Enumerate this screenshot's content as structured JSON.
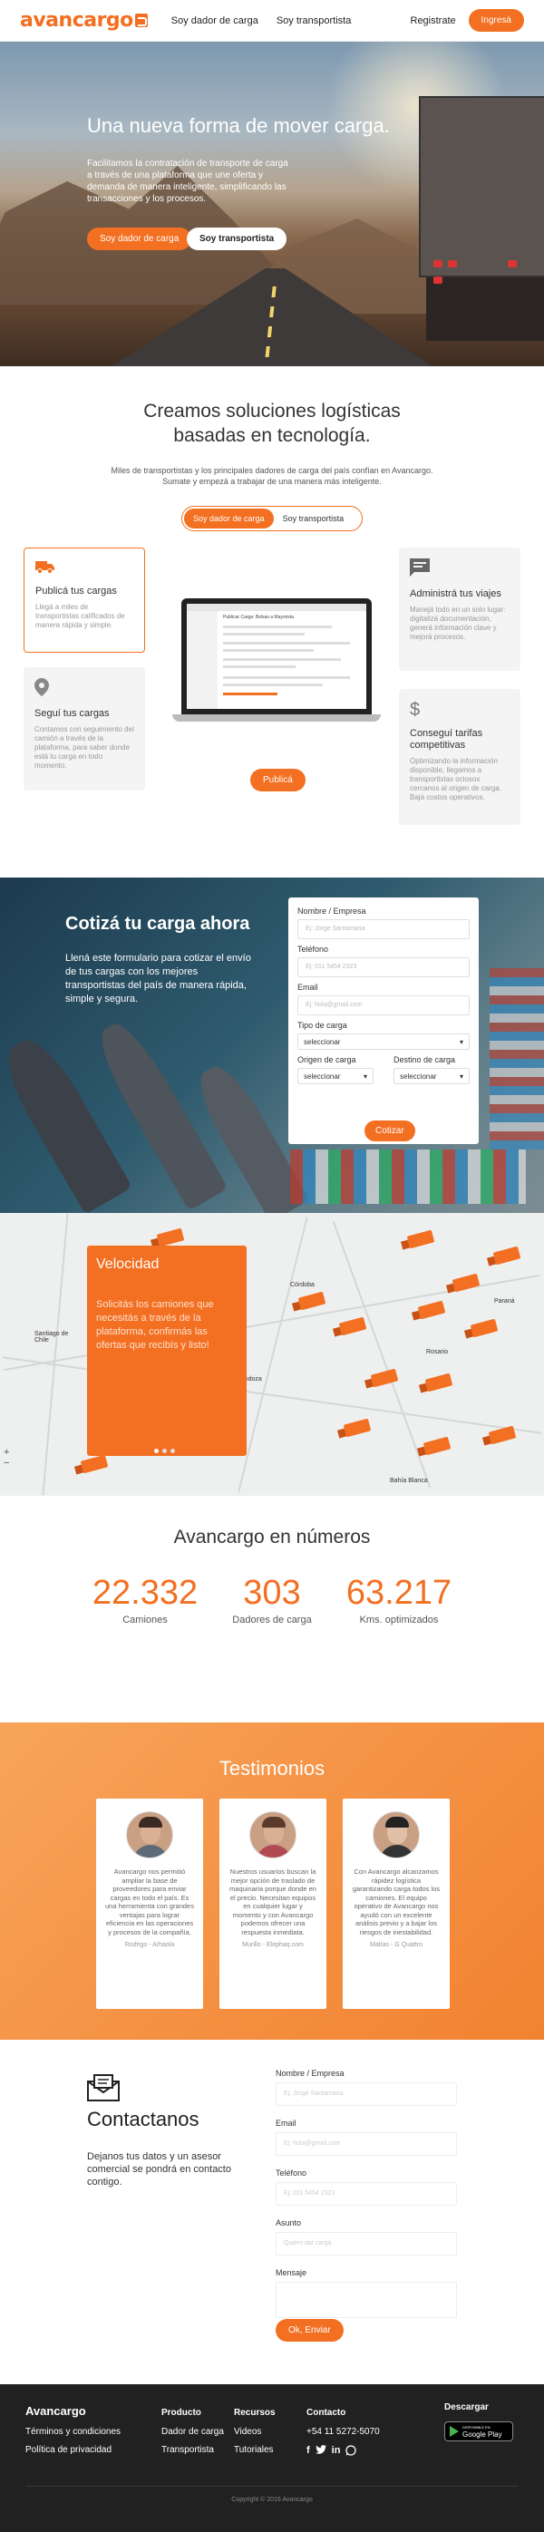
{
  "nav": {
    "logo": "avancargo",
    "links": [
      "Soy dador de carga",
      "Soy transportista"
    ],
    "register": "Registrate",
    "login": "Ingresá"
  },
  "hero": {
    "title": "Una nueva forma de mover carga.",
    "text": "Facilitamos la contratación de transporte de carga a través de una plataforma que une oferta y demanda de manera inteligente, simplificando las transacciones y los procesos.",
    "btn_dador": "Soy dador de carga",
    "btn_transportista": "Soy transportista"
  },
  "soluciones": {
    "title": "Creamos soluciones logísticas basadas en tecnología.",
    "text": "Miles de transportistas y los principales dadores de carga del país confían en Avancargo. Sumate y empezá a trabajar de una manera más inteligente.",
    "toggle_on": "Soy dador de carga",
    "toggle_off": "Soy transportista",
    "cards": [
      {
        "title": "Publicá tus cargas",
        "text": "Llegá a miles de transportistas calificados de manera rápida y simple.",
        "icon": "truck-icon"
      },
      {
        "title": "Seguí tus cargas",
        "text": "Contamos con seguimiento del camión a través de la plataforma, para saber donde está tu carga en todo momento.",
        "icon": "location-pin-icon"
      },
      {
        "title": "Administrá tus viajes",
        "text": "Manejá todo en un solo lugar: digitalizá documentación, generá información clave y mejorá procesos.",
        "icon": "chat-icon"
      },
      {
        "title": "Conseguí tarifas competitivas",
        "text": "Optimizando la información disponible, llegamos a transportistas ociosos cercanos al origen de carga. Bajá costos operativos.",
        "icon": "dollar-icon"
      }
    ],
    "laptop_screen_title": "Publicar Carga: Bolsas a Mayorista",
    "cta": "Publicá"
  },
  "cotiza": {
    "title": "Cotizá tu carga ahora",
    "text": "Llená este formulario para cotizar el envío de tus cargas con los mejores transportistas del país de manera rápida, simple y segura.",
    "labels": {
      "name": "Nombre / Empresa",
      "phone": "Teléfono",
      "email": "Email",
      "type": "Tipo de carga",
      "origin": "Origen de carga",
      "dest": "Destino de carga"
    },
    "placeholders": {
      "name": "Ej: Jorge Santamaria",
      "phone": "Ej: 011 5454 2323",
      "email": "Ej: hola@gmail.com"
    },
    "select": "seleccionar",
    "button": "Cotizar"
  },
  "velocidad": {
    "title": "Velocidad",
    "text": "Solicitás los camiones que necesitás a través de la plataforma, confirmás las ofertas que recibís y listo!"
  },
  "map_labels": [
    "Santiago de Chile",
    "Córdoba",
    "Rosario",
    "Paraná",
    "Mendoza",
    "Bahía Blanca"
  ],
  "numeros": {
    "title": "Avancargo en números",
    "items": [
      {
        "value": "22.332",
        "label": "Camiones"
      },
      {
        "value": "303",
        "label": "Dadores de carga"
      },
      {
        "value": "63.217",
        "label": "Kms. optimizados"
      }
    ]
  },
  "testimonios": {
    "title": "Testimonios",
    "items": [
      {
        "quote": "Avancargo nos permitió ampliar la base de proveedores para enviar cargas en todo el país. Es una herramienta con grandes ventajas para lograr eficiencia en las operaciones y procesos de la compañía.",
        "name": "Rodrigo - Arhaola"
      },
      {
        "quote": "Nuestros usuarios buscan la mejor opción de traslado de maquinaria porque donde en el precio. Necesitan equipos en cualquier lugar y momento y con Avancargo podemos ofrecer una respuesta inmediata.",
        "name": "Murillo - Elephaq.com"
      },
      {
        "quote": "Con Avancargo alcanzamos rápidez logística garantizando carga todos los camiones. El equipo operativo de Avancargo nos ayudó con un excelente análisis previo y a bajar los riesgos de inestabilidad.",
        "name": "Matías - G Quattro"
      }
    ]
  },
  "contacto": {
    "title": "Contactanos",
    "text": "Dejanos tus datos y un asesor comercial se pondrá en contacto contigo.",
    "labels": {
      "name": "Nombre / Empresa",
      "email": "Email",
      "phone": "Teléfono",
      "subject": "Asunto",
      "message": "Mensaje"
    },
    "placeholders": {
      "name": "Ej: Jorge Santamaria",
      "email": "Ej: hola@gmail.com",
      "phone": "Ej: 011 5454 2323",
      "subject": "Quiero dar carga"
    },
    "button": "Ok, Enviar"
  },
  "footer": {
    "brand": "Avancargo",
    "brand_links": [
      "Términos y condiciones",
      "Política de privacidad"
    ],
    "producto_head": "Producto",
    "producto_links": [
      "Dador de carga",
      "Transportista"
    ],
    "recursos_head": "Recursos",
    "recursos_links": [
      "Videos",
      "Tutoriales"
    ],
    "contacto_head": "Contacto",
    "phone": "+54 11 5272-5070",
    "descargar_head": "Descargar",
    "gplay_small": "DISPONIBLE EN",
    "gplay_big": "Google Play",
    "copyright": "Copyright © 2016 Avancargo"
  }
}
